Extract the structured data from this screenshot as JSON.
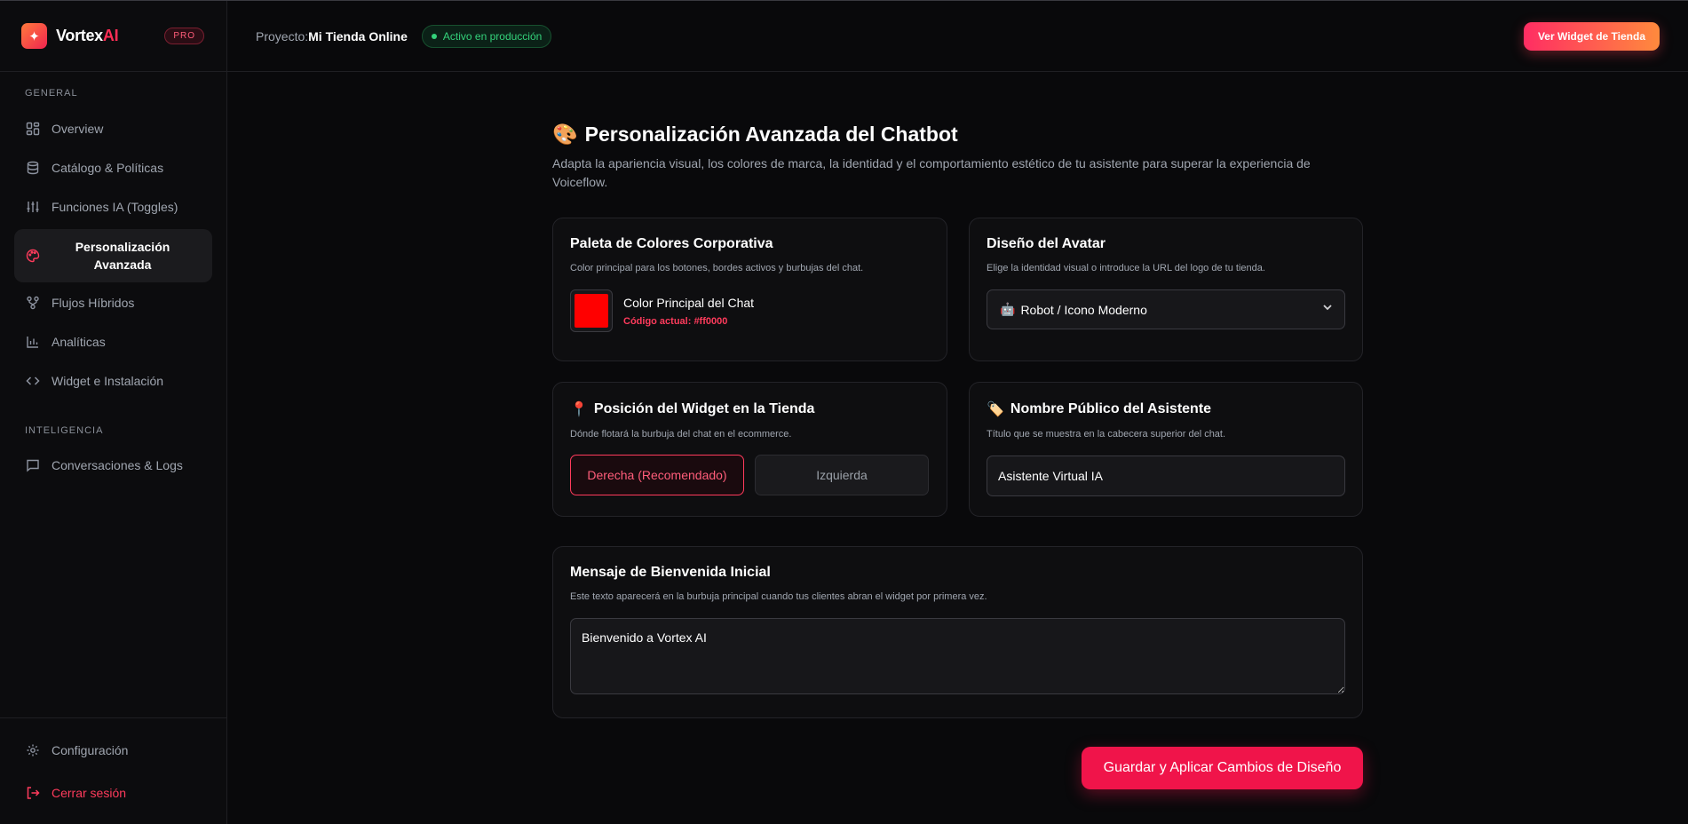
{
  "brand": {
    "name_main": "Vortex",
    "name_accent": "AI",
    "plan": "PRO"
  },
  "sidebar": {
    "section_general": "GENERAL",
    "section_intel": "INTELIGENCIA",
    "items": [
      {
        "label": "Overview",
        "icon": "dashboard-grid-icon"
      },
      {
        "label": "Catálogo & Políticas",
        "icon": "database-icon"
      },
      {
        "label": "Funciones IA (Toggles)",
        "icon": "sliders-icon"
      },
      {
        "label": "Personalización Avanzada",
        "icon": "palette-icon",
        "active": true
      },
      {
        "label": "Flujos Híbridos",
        "icon": "workflow-icon"
      },
      {
        "label": "Analíticas",
        "icon": "bar-chart-icon"
      },
      {
        "label": "Widget e Instalación",
        "icon": "code-icon"
      },
      {
        "label": "Conversaciones & Logs",
        "icon": "chat-icon"
      }
    ],
    "settings_label": "Configuración",
    "logout_label": "Cerrar sesión"
  },
  "header": {
    "project_prefix": "Proyecto:",
    "project_name": "Mi Tienda Online",
    "status": "Activo en producción",
    "widget_button": "Ver Widget de Tienda"
  },
  "main": {
    "title": "Personalización Avanzada del Chatbot",
    "description": "Adapta la apariencia visual, los colores de marca, la identidad y el comportamiento estético de tu asistente para superar la experiencia de Voiceflow.",
    "palette": {
      "title": "Paleta de Colores Corporativa",
      "subtitle": "Color principal para los botones, bordes activos y burbujas del chat.",
      "label": "Color Principal del Chat",
      "code_text": "Código actual: #ff0000",
      "color": "#ff0000"
    },
    "avatar": {
      "title": "Diseño del Avatar",
      "subtitle": "Elige la identidad visual o introduce la URL del logo de tu tienda.",
      "selected": "Robot / Icono Moderno"
    },
    "position": {
      "title": "Posición del Widget en la Tienda",
      "subtitle": "Dónde flotará la burbuja del chat en el ecommerce.",
      "right_label": "Derecha (Recomendado)",
      "left_label": "Izquierda"
    },
    "name": {
      "title": "Nombre Público del Asistente",
      "subtitle": "Título que se muestra en la cabecera superior del chat.",
      "value": "Asistente Virtual IA"
    },
    "welcome": {
      "title": "Mensaje de Bienvenida Inicial",
      "subtitle": "Este texto aparecerá en la burbuja principal cuando tus clientes abran el widget por primera vez.",
      "value": "Bienvenido a Vortex AI"
    },
    "save_button": "Guardar y Aplicar Cambios de Diseño"
  },
  "colors": {
    "accent": "#ff2d55",
    "success": "#34d27b",
    "background": "#09090b"
  }
}
